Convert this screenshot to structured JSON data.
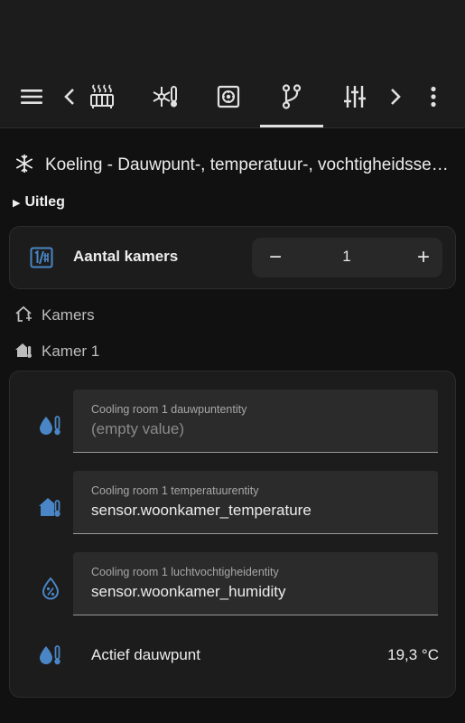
{
  "colors": {
    "background": "#111111",
    "topbar": "#1c1c1c",
    "card": "#1c1c1c",
    "field": "#2b2b2b",
    "accent_icon": "#4a86c5",
    "text": "#e1e1e1"
  },
  "toolbar": {
    "icons": [
      "menu-icon",
      "chevron-left-icon",
      "radiator-icon",
      "snowflake-thermometer-icon",
      "safe-icon",
      "source-branch-icon",
      "tune-vertical-icon",
      "chevron-right-icon",
      "dots-vertical-icon"
    ],
    "active_tab": "source-branch-icon"
  },
  "header": {
    "icon": "snowflake-icon",
    "title": "Koeling - Dauwpunt-, temperatuur-, vochtigheidssensoren"
  },
  "uitleg": {
    "label": "Uitleg"
  },
  "rooms_count": {
    "icon": "numeric-box-icon",
    "label": "Aantal kamers",
    "value": "1",
    "minus": "−",
    "plus": "+"
  },
  "sections": {
    "kamers": "Kamers",
    "kamer1": "Kamer 1"
  },
  "fields": [
    {
      "icon": "water-thermometer-icon",
      "label": "Cooling room 1 dauwpuntentity",
      "value": "(empty value)"
    },
    {
      "icon": "home-thermometer-icon",
      "label": "Cooling room 1 temperatuurentity",
      "value": "sensor.woonkamer_temperature"
    },
    {
      "icon": "water-percent-icon",
      "label": "Cooling room 1 luchtvochtigheidentity",
      "value": "sensor.woonkamer_humidity"
    }
  ],
  "dewpoint": {
    "icon": "water-thermometer-icon",
    "label": "Actief dauwpunt",
    "value": "19,3 °C"
  }
}
